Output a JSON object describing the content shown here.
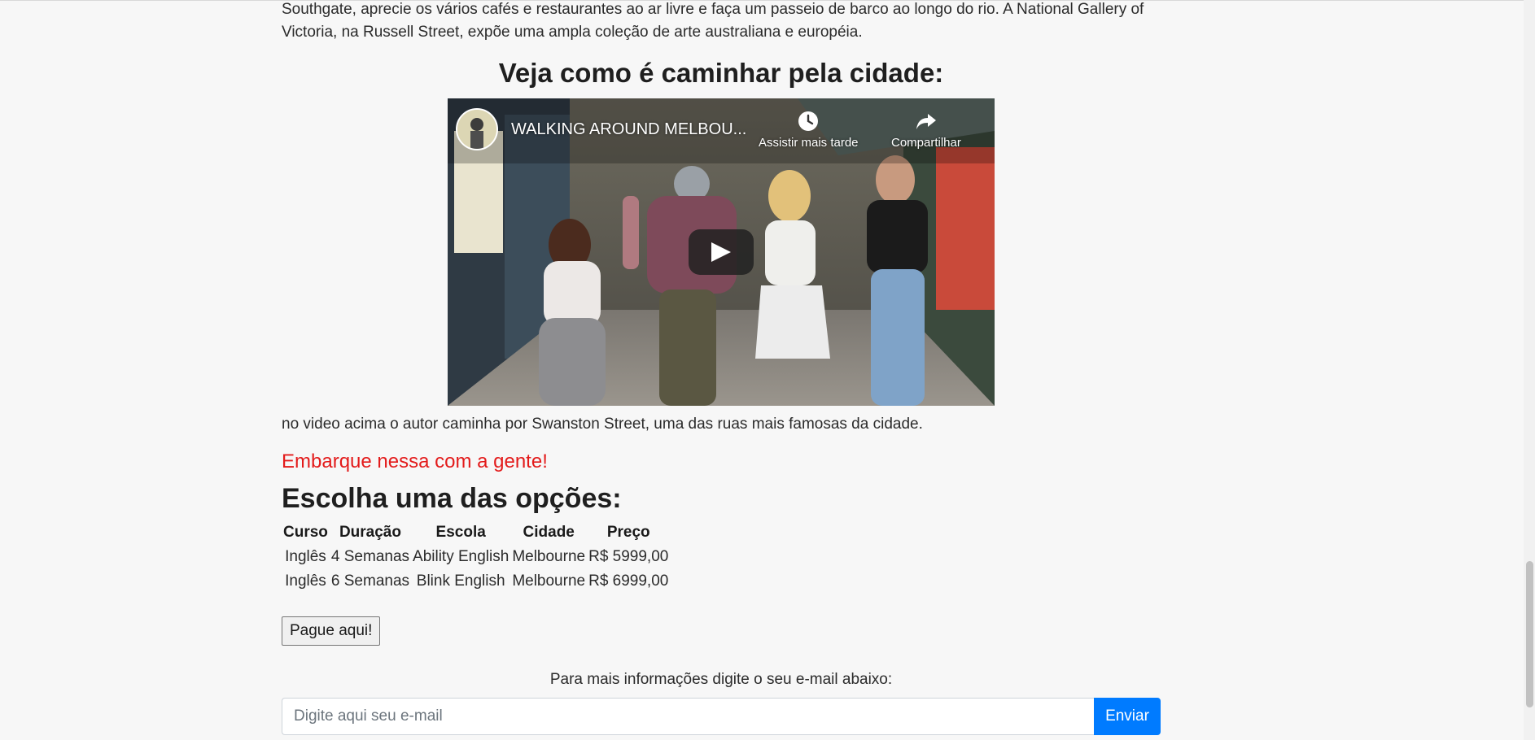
{
  "article": {
    "intro_text": "Southgate, aprecie os vários cafés e restaurantes ao ar livre e faça um passeio de barco ao longo do rio. A National Gallery of Victoria, na Russell Street, expõe uma ampla coleção de arte australiana e européia.",
    "video_heading": "Veja como é caminhar pela cidade:",
    "video_caption": "no video acima o autor caminha por Swanston Street, uma das ruas mais famosas da cidade.",
    "promo_text": "Embarque nessa com a gente!",
    "options_heading": "Escolha uma das opções:"
  },
  "video": {
    "title": "WALKING AROUND MELBOU...",
    "watch_later_label": "Assistir mais tarde",
    "share_label": "Compartilhar",
    "channel_avatar_icon": "channel-avatar-icon",
    "play_icon": "play-icon"
  },
  "options_table": {
    "headers": [
      "Curso",
      "Duração",
      "Escola",
      "Cidade",
      "Preço"
    ],
    "rows": [
      [
        "Inglês",
        "4 Semanas",
        "Ability English",
        "Melbourne",
        "R$ 5999,00"
      ],
      [
        "Inglês",
        "6 Semanas",
        "Blink English",
        "Melbourne",
        "R$ 6999,00"
      ]
    ]
  },
  "pay_button_label": "Pague aqui!",
  "newsletter": {
    "prompt": "Para mais informações digite o seu e-mail abaixo:",
    "email_placeholder": "Digite aqui seu e-mail",
    "send_label": "Enviar"
  },
  "colors": {
    "promo": "#e31b1b",
    "send_button": "#007bff"
  }
}
